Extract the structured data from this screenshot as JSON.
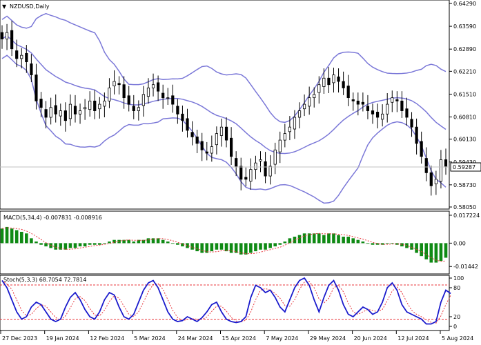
{
  "window": {
    "arrow": "▼",
    "title": "NZDUSD,Daily"
  },
  "colors": {
    "candle": "#000000",
    "bollinger": "#7b78d8",
    "macd_hist": "#0f8a14",
    "macd_signal": "#e8343a",
    "stoch_main": "#1a1acc",
    "stoch_signal": "#e8343a",
    "level_line": "#e8343a",
    "current_price_bg": "#ffffff"
  },
  "chart_data": [
    {
      "type": "candlestick",
      "title": "NZDUSD,Daily",
      "y_ticks": [
        "0.64290",
        "0.63590",
        "0.62890",
        "0.62210",
        "0.61510",
        "0.60810",
        "0.60130",
        "0.59430",
        "0.58730",
        "0.58050"
      ],
      "current_price": "0.59287",
      "ylim": [
        0.5805,
        0.6429
      ],
      "x_labels": [
        "27 Dec 2023",
        "19 Jan 2024",
        "12 Feb 2024",
        "5 Mar 2024",
        "24 Mar 2024",
        "15 Apr 2024",
        "7 May 2024",
        "29 May 2024",
        "20 Jun 2024",
        "12 Jul 2024",
        "5 Aug 2024"
      ],
      "close_approx": [
        0.632,
        0.634,
        0.629,
        0.626,
        0.627,
        0.625,
        0.621,
        0.613,
        0.611,
        0.608,
        0.611,
        0.609,
        0.61,
        0.607,
        0.612,
        0.609,
        0.61,
        0.611,
        0.613,
        0.61,
        0.612,
        0.613,
        0.617,
        0.619,
        0.618,
        0.614,
        0.612,
        0.61,
        0.611,
        0.615,
        0.617,
        0.618,
        0.616,
        0.614,
        0.614,
        0.612,
        0.609,
        0.607,
        0.604,
        0.602,
        0.6,
        0.598,
        0.597,
        0.599,
        0.603,
        0.605,
        0.601,
        0.596,
        0.593,
        0.589,
        0.589,
        0.592,
        0.594,
        0.595,
        0.59,
        0.593,
        0.598,
        0.601,
        0.603,
        0.605,
        0.608,
        0.61,
        0.612,
        0.614,
        0.615,
        0.618,
        0.62,
        0.618,
        0.621,
        0.619,
        0.617,
        0.614,
        0.613,
        0.612,
        0.612,
        0.61,
        0.609,
        0.608,
        0.609,
        0.612,
        0.614,
        0.613,
        0.61,
        0.608,
        0.605,
        0.6,
        0.596,
        0.591,
        0.587,
        0.589,
        0.595,
        0.593
      ],
      "bollinger_bands": [
        "upper",
        "middle",
        "lower"
      ]
    },
    {
      "type": "bar",
      "label": "MACD(5,34,4) -0.007831 -0.008916",
      "y_ticks": [
        "0.017224",
        "0.00",
        "-0.01442"
      ],
      "ylim": [
        -0.0173,
        0.0172
      ],
      "histogram_approx": [
        0.009,
        0.01,
        0.009,
        0.008,
        0.007,
        0.006,
        0.003,
        0.001,
        -0.001,
        -0.002,
        -0.003,
        -0.004,
        -0.004,
        -0.004,
        -0.003,
        -0.003,
        -0.002,
        -0.002,
        -0.001,
        -0.001,
        -0.001,
        0.0,
        0.001,
        0.002,
        0.002,
        0.002,
        0.002,
        0.001,
        0.002,
        0.002,
        0.003,
        0.003,
        0.003,
        0.002,
        0.001,
        0.0,
        -0.001,
        -0.002,
        -0.003,
        -0.004,
        -0.005,
        -0.006,
        -0.006,
        -0.005,
        -0.004,
        -0.004,
        -0.005,
        -0.006,
        -0.006,
        -0.007,
        -0.007,
        -0.006,
        -0.005,
        -0.004,
        -0.004,
        -0.003,
        -0.002,
        -0.001,
        0.001,
        0.003,
        0.004,
        0.005,
        0.006,
        0.006,
        0.006,
        0.006,
        0.005,
        0.006,
        0.006,
        0.005,
        0.004,
        0.004,
        0.003,
        0.002,
        0.001,
        0.0,
        -0.001,
        -0.001,
        -0.001,
        0.0,
        0.0,
        -0.001,
        -0.002,
        -0.003,
        -0.004,
        -0.006,
        -0.008,
        -0.01,
        -0.012,
        -0.012,
        -0.011,
        -0.009
      ],
      "signal_line": "dashed"
    },
    {
      "type": "line",
      "label": "Stoch(5,3,3) 68.7054 72.7814",
      "y_ticks": [
        "100",
        "80",
        "20",
        "0"
      ],
      "levels": [
        80,
        20
      ],
      "ylim": [
        0,
        100
      ],
      "main_approx": [
        95,
        80,
        55,
        30,
        15,
        20,
        40,
        50,
        45,
        30,
        15,
        10,
        15,
        40,
        60,
        70,
        55,
        35,
        20,
        15,
        30,
        55,
        70,
        65,
        40,
        20,
        15,
        25,
        50,
        75,
        90,
        95,
        80,
        55,
        30,
        15,
        10,
        12,
        20,
        15,
        10,
        18,
        30,
        45,
        50,
        30,
        15,
        10,
        8,
        10,
        20,
        60,
        85,
        80,
        70,
        75,
        60,
        40,
        30,
        55,
        80,
        95,
        100,
        85,
        55,
        30,
        60,
        85,
        95,
        75,
        45,
        25,
        20,
        30,
        40,
        35,
        25,
        30,
        50,
        80,
        90,
        75,
        45,
        30,
        25,
        20,
        15,
        5,
        5,
        10,
        50,
        75,
        68
      ],
      "signal_line": "dashed"
    }
  ]
}
